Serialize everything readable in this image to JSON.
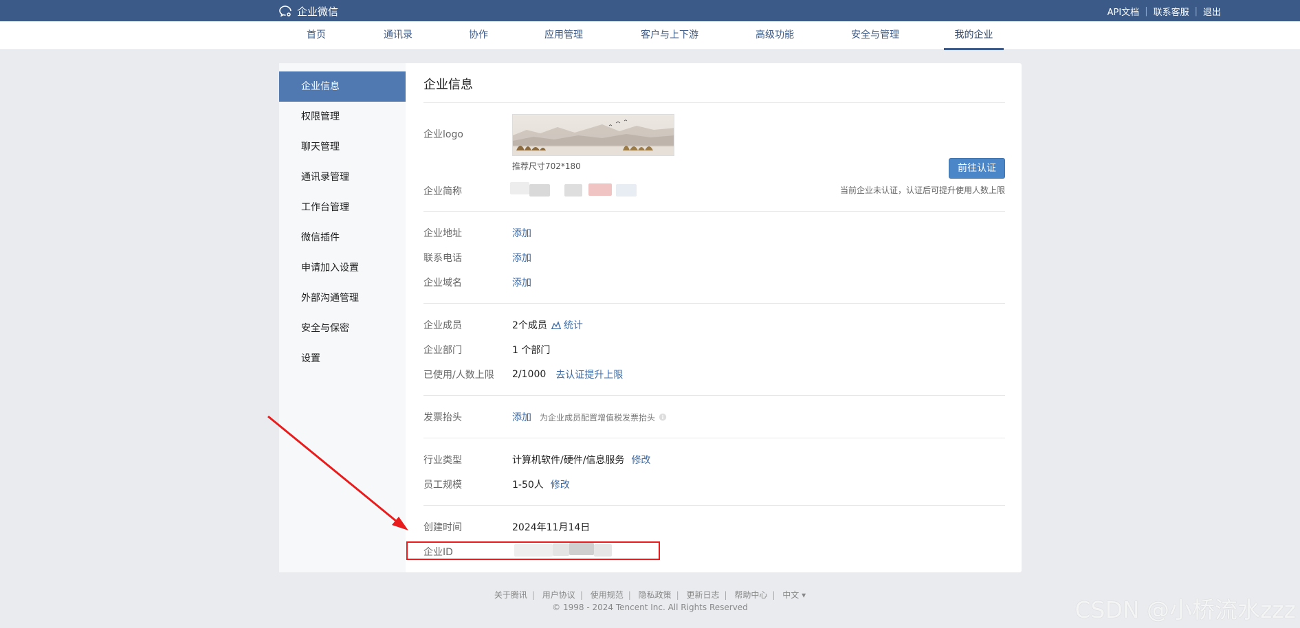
{
  "topbar": {
    "brand": "企业微信",
    "links": [
      "API文档",
      "联系客服",
      "退出"
    ]
  },
  "nav": {
    "items": [
      "首页",
      "通讯录",
      "协作",
      "应用管理",
      "客户与上下游",
      "高级功能",
      "安全与管理",
      "我的企业"
    ],
    "active": "我的企业"
  },
  "sidebar": {
    "items": [
      "企业信息",
      "权限管理",
      "聊天管理",
      "通讯录管理",
      "工作台管理",
      "微信插件",
      "申请加入设置",
      "外部沟通管理",
      "安全与保密",
      "设置"
    ],
    "active": "企业信息"
  },
  "main": {
    "title": "企业信息",
    "logo": {
      "label": "企业logo",
      "size_hint": "推荐尺寸702*180"
    },
    "short_name": {
      "label": "企业简称"
    },
    "cert_button": "前往认证",
    "cert_note": "当前企业未认证，认证后可提升使用人数上限",
    "address": {
      "label": "企业地址",
      "action": "添加"
    },
    "phone": {
      "label": "联系电话",
      "action": "添加"
    },
    "domain": {
      "label": "企业域名",
      "action": "添加"
    },
    "members": {
      "label": "企业成员",
      "value": "2个成员",
      "action": "统计"
    },
    "departments": {
      "label": "企业部门",
      "value": "1 个部门"
    },
    "usage": {
      "label": "已使用/人数上限",
      "value": "2/1000",
      "action": "去认证提升上限"
    },
    "invoice": {
      "label": "发票抬头",
      "action": "添加",
      "hint": "为企业成员配置增值税发票抬头"
    },
    "industry": {
      "label": "行业类型",
      "value": "计算机软件/硬件/信息服务",
      "action": "修改"
    },
    "staff": {
      "label": "员工规模",
      "value": "1-50人",
      "action": "修改"
    },
    "created": {
      "label": "创建时间",
      "value": "2024年11月14日"
    },
    "corp_id": {
      "label": "企业ID"
    }
  },
  "footer": {
    "links": [
      "关于腾讯",
      "用户协议",
      "使用规范",
      "隐私政策",
      "更新日志",
      "帮助中心",
      "中文 ▾"
    ],
    "copyright": "© 1998 - 2024 Tencent Inc. All Rights Reserved"
  },
  "watermark": "CSDN @小桥流水zzz",
  "colors": {
    "header": "#3b5a87",
    "accent": "#4f79b0",
    "link": "#3b6aa6",
    "annotation": "#e81c1c"
  }
}
